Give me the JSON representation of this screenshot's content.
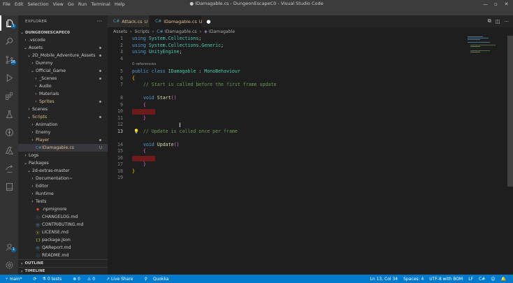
{
  "window": {
    "title": "● IDamagable.cs - DungeonEscapeC0 - Visual Studio Code",
    "menu": [
      "File",
      "Edit",
      "Selection",
      "View",
      "Go",
      "Run",
      "Terminal",
      "Help"
    ],
    "controls": [
      "—",
      "▫",
      "✕"
    ]
  },
  "activity_bar": {
    "items": [
      {
        "name": "explorer-icon",
        "badge": "1"
      },
      {
        "name": "search-icon",
        "badge": ""
      },
      {
        "name": "source-control-icon",
        "badge": "26"
      },
      {
        "name": "run-debug-icon",
        "badge": ""
      },
      {
        "name": "extensions-icon",
        "badge": ""
      },
      {
        "name": "testing-icon",
        "badge": ""
      },
      {
        "name": "gitlens-icon",
        "badge": ""
      },
      {
        "name": "azure-icon",
        "badge": ""
      },
      {
        "name": "live-share-icon",
        "badge": ""
      },
      {
        "name": "remote-explorer-icon",
        "badge": ""
      }
    ],
    "account_badge": "1"
  },
  "sidebar": {
    "title": "EXPLORER",
    "more": "···",
    "tree": [
      {
        "label": "DUNGEONESCAPEC0",
        "depth": 0,
        "type": "root",
        "open": true
      },
      {
        "label": ".vscode",
        "depth": 1,
        "type": "folder",
        "open": false
      },
      {
        "label": "Assets",
        "depth": 1,
        "type": "folder",
        "open": true,
        "dot": true
      },
      {
        "label": "2D_Mobile_Adventure_Assets",
        "depth": 2,
        "type": "folder",
        "open": true,
        "dot": true
      },
      {
        "label": "Dummy",
        "depth": 3,
        "type": "folder",
        "open": false
      },
      {
        "label": "Official_Game",
        "depth": 3,
        "type": "folder",
        "open": true,
        "dot": true
      },
      {
        "label": "_Scenes",
        "depth": 4,
        "type": "folder",
        "open": false,
        "dot": true
      },
      {
        "label": "Audio",
        "depth": 4,
        "type": "folder",
        "open": false
      },
      {
        "label": "Materials",
        "depth": 4,
        "type": "folder",
        "open": false
      },
      {
        "label": "Sprites",
        "depth": 4,
        "type": "folder",
        "open": false,
        "dot": true,
        "modified": true
      },
      {
        "label": "Scenes",
        "depth": 2,
        "type": "folder",
        "open": false
      },
      {
        "label": "Scripts",
        "depth": 2,
        "type": "folder",
        "open": true,
        "dot": true,
        "modified": true
      },
      {
        "label": "Animation",
        "depth": 3,
        "type": "folder",
        "open": false
      },
      {
        "label": "Enemy",
        "depth": 3,
        "type": "folder",
        "open": false
      },
      {
        "label": "Player",
        "depth": 3,
        "type": "folder",
        "open": false,
        "dot": true,
        "modified": true
      },
      {
        "label": "IDamagable.cs",
        "depth": 3,
        "type": "cs",
        "selected": true,
        "badge": "U",
        "modified": true
      },
      {
        "label": "Logs",
        "depth": 1,
        "type": "folder",
        "open": false
      },
      {
        "label": "Packages",
        "depth": 1,
        "type": "folder",
        "open": true
      },
      {
        "label": "2d-extras-master",
        "depth": 2,
        "type": "folder",
        "open": true
      },
      {
        "label": "Documentation~",
        "depth": 3,
        "type": "folder",
        "open": false
      },
      {
        "label": "Editor",
        "depth": 3,
        "type": "folder",
        "open": false
      },
      {
        "label": "Runtime",
        "depth": 3,
        "type": "folder",
        "open": false
      },
      {
        "label": "Tests",
        "depth": 3,
        "type": "folder",
        "open": false
      },
      {
        "label": ".npmignore",
        "depth": 3,
        "type": "ignore"
      },
      {
        "label": "CHANGELOG.md",
        "depth": 3,
        "type": "info"
      },
      {
        "label": "CONTRIBUTING.md",
        "depth": 3,
        "type": "md"
      },
      {
        "label": "LICENSE.md",
        "depth": 3,
        "type": "license"
      },
      {
        "label": "package.json",
        "depth": 3,
        "type": "json"
      },
      {
        "label": "QAReport.md",
        "depth": 3,
        "type": "md"
      },
      {
        "label": "README.md",
        "depth": 3,
        "type": "info"
      }
    ],
    "outline": "OUTLINE",
    "timeline": "TIMELINE"
  },
  "tabs": [
    {
      "label": "Attack.cs",
      "status": "U",
      "active": false
    },
    {
      "label": "IDamagable.cs",
      "status": "U",
      "active": true,
      "dirty": "●"
    }
  ],
  "tab_actions": [
    "⧉",
    "◫",
    "···"
  ],
  "breadcrumb": [
    "Assets",
    "Scripts",
    "IDamagable.cs",
    "IDamagable"
  ],
  "editor": {
    "code_lens": "0 references",
    "lines": [
      {
        "n": "1",
        "tokens": [
          [
            "kw",
            "using "
          ],
          [
            "ns",
            "System.Collections"
          ],
          [
            "",
            "; "
          ]
        ]
      },
      {
        "n": "2",
        "tokens": [
          [
            "kw",
            "using "
          ],
          [
            "ns",
            "System.Collections.Generic"
          ],
          [
            "",
            ";"
          ]
        ]
      },
      {
        "n": "3",
        "tokens": [
          [
            "kw",
            "using "
          ],
          [
            "ns",
            "UnityEngine"
          ],
          [
            "",
            ";"
          ]
        ]
      },
      {
        "n": "4",
        "tokens": []
      },
      {
        "n": "5",
        "tokens": [
          [
            "kw",
            "public class "
          ],
          [
            "ns",
            "IDamagable"
          ],
          [
            "",
            " : "
          ],
          [
            "ns",
            "MonoBehaviour"
          ]
        ]
      },
      {
        "n": "6",
        "tokens": [
          [
            "br",
            "{"
          ]
        ]
      },
      {
        "n": "7",
        "tokens": [
          [
            "",
            "    "
          ],
          [
            "cm",
            "// Start is called before the first frame update"
          ]
        ]
      },
      {
        "n": "8",
        "tokens": [
          [
            "",
            "    "
          ],
          [
            "kw",
            "void "
          ],
          [
            "fn",
            "Start"
          ],
          [
            "br2",
            "()"
          ]
        ]
      },
      {
        "n": "9",
        "tokens": [
          [
            "",
            "    "
          ],
          [
            "br2",
            "{"
          ]
        ]
      },
      {
        "n": "10",
        "tokens": []
      },
      {
        "n": "11",
        "tokens": [
          [
            "",
            "    "
          ],
          [
            "br2",
            "}"
          ]
        ]
      },
      {
        "n": "12",
        "tokens": []
      },
      {
        "n": "13",
        "tokens": [
          [
            "",
            "    "
          ],
          [
            "cm",
            "// Update is called once per frame"
          ]
        ]
      },
      {
        "n": "14",
        "tokens": [
          [
            "",
            "    "
          ],
          [
            "kw",
            "void "
          ],
          [
            "fn",
            "Update"
          ],
          [
            "br2",
            "()"
          ]
        ]
      },
      {
        "n": "15",
        "tokens": [
          [
            "",
            "    "
          ],
          [
            "br2",
            "{"
          ]
        ]
      },
      {
        "n": "16",
        "tokens": []
      },
      {
        "n": "17",
        "tokens": [
          [
            "",
            "    "
          ],
          [
            "br2",
            "}"
          ]
        ]
      },
      {
        "n": "18",
        "tokens": [
          [
            "br",
            "}"
          ]
        ]
      },
      {
        "n": "19",
        "tokens": []
      }
    ],
    "current_line": "13"
  },
  "status_bar": {
    "branch": "main*",
    "sync": "⟳",
    "tests": "0 tests",
    "errors": "0",
    "warnings": "0",
    "live_share": "Live Share",
    "quokka": "Quokka",
    "position": "Ln 13, Col 34",
    "spaces": "Spaces: 4",
    "encoding": "UTF-8 with BOM",
    "eol": "LF",
    "language": "C#"
  }
}
